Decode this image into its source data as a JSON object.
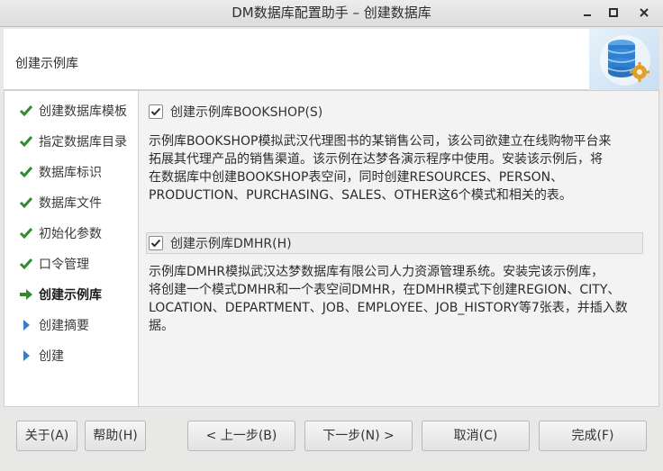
{
  "window": {
    "title": "DM数据库配置助手 – 创建数据库",
    "controls": [
      "minimize-icon",
      "maximize-icon",
      "close-icon"
    ]
  },
  "header": {
    "step_title": "创建示例库",
    "logo": "database-gear-icon"
  },
  "sidebar": {
    "items": [
      {
        "label": "创建数据库模板",
        "state": "done"
      },
      {
        "label": "指定数据库目录",
        "state": "done"
      },
      {
        "label": "数据库标识",
        "state": "done"
      },
      {
        "label": "数据库文件",
        "state": "done"
      },
      {
        "label": "初始化参数",
        "state": "done"
      },
      {
        "label": "口令管理",
        "state": "done"
      },
      {
        "label": "创建示例库",
        "state": "current"
      },
      {
        "label": "创建摘要",
        "state": "pending"
      },
      {
        "label": "创建",
        "state": "pending"
      }
    ]
  },
  "content": {
    "bookshop": {
      "checkbox_label": "创建示例库BOOKSHOP(S)",
      "checked": true,
      "description": [
        "示例库BOOKSHOP模拟武汉代理图书的某销售公司，该公司欲建立在线购物平台来",
        "拓展其代理产品的销售渠道。该示例在达梦各演示程序中使用。安装该示例后，将",
        "在数据库中创建BOOKSHOP表空间，同时创建RESOURCES、PERSON、",
        "PRODUCTION、PURCHASING、SALES、OTHER这6个模式和相关的表。"
      ]
    },
    "dmhr": {
      "checkbox_label": "创建示例库DMHR(H)",
      "checked": true,
      "description": [
        "示例库DMHR模拟武汉达梦数据库有限公司人力资源管理系统。安装完该示例库，",
        "将创建一个模式DMHR和一个表空间DMHR，在DMHR模式下创建REGION、CITY、",
        "LOCATION、DEPARTMENT、JOB、EMPLOYEE、JOB_HISTORY等7张表，并插入数",
        "据。"
      ]
    }
  },
  "buttons": {
    "about": "关于(A)",
    "help": "帮助(H)",
    "back": "< 上一步(B)",
    "next": "下一步(N) >",
    "cancel": "取消(C)",
    "finish": "完成(F)"
  },
  "colors": {
    "check_green": "#2e8b2e",
    "current_arrow": "#2e8b2e",
    "pending_triangle": "#3b7dc4"
  }
}
